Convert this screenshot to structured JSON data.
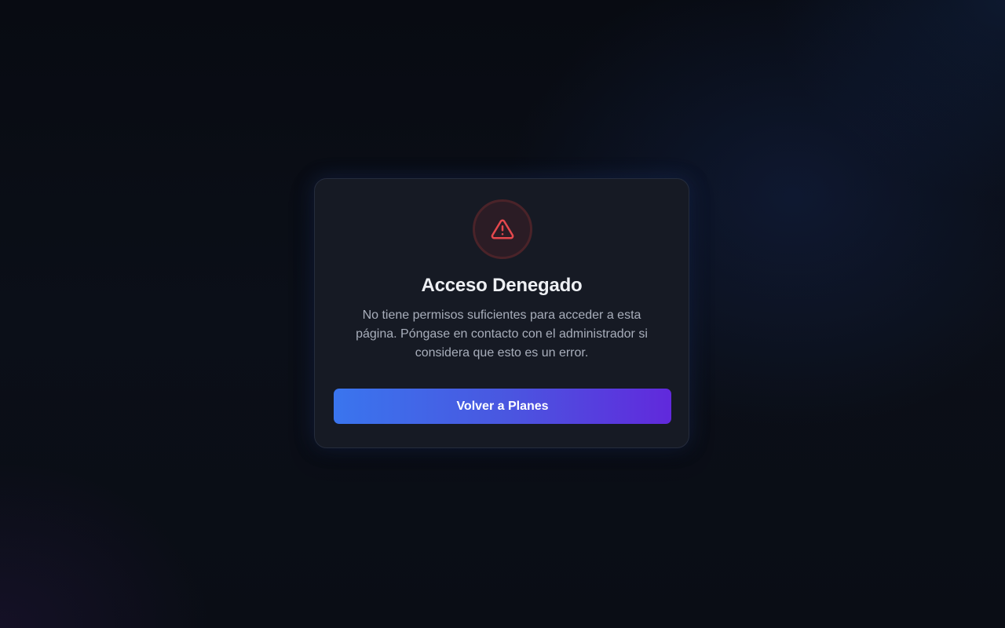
{
  "dialog": {
    "icon": "warning-triangle-icon",
    "title": "Acceso Denegado",
    "message": "No tiene permisos suficientes para acceder a esta página. Póngase en contacto con el administrador si considera que esto es un error.",
    "button_label": "Volver a Planes"
  },
  "colors": {
    "background": "#0a0d14",
    "card": "#161a24",
    "card_border": "#252c3c",
    "warning": "#e5484d",
    "button_gradient_start": "#3a75ee",
    "button_gradient_end": "#6129dc"
  }
}
